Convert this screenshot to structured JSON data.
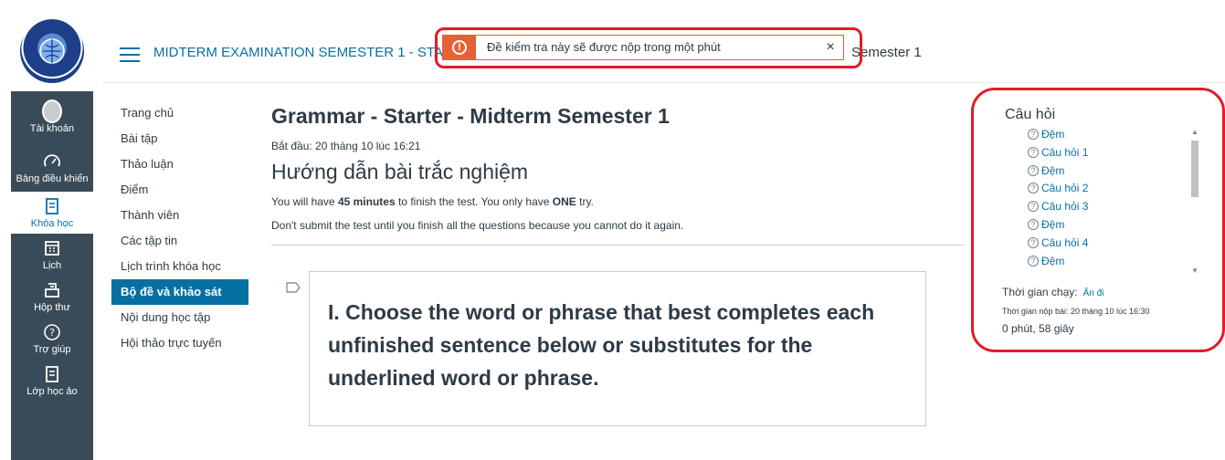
{
  "header": {
    "course_title": "MIDTERM EXAMINATION SEMESTER 1 - STA",
    "course_title_tail": "Semester 1"
  },
  "alert": {
    "icon": "exclamation-icon",
    "message": "Đề kiểm tra này sẽ được nộp trong một phút",
    "close_label": "×",
    "accent_color": "#e66135"
  },
  "global_nav": {
    "items": [
      {
        "label": "Tài khoản",
        "icon": "account-avatar-icon"
      },
      {
        "label": "Bảng điều khiển",
        "icon": "dashboard-icon"
      },
      {
        "label": "Khóa học",
        "icon": "courses-icon",
        "active": true
      },
      {
        "label": "Lịch",
        "icon": "calendar-icon"
      },
      {
        "label": "Hộp thư",
        "icon": "inbox-icon"
      },
      {
        "label": "Trợ giúp",
        "icon": "help-icon"
      },
      {
        "label": "Lớp học ảo",
        "icon": "virtual-class-icon"
      }
    ]
  },
  "course_nav": {
    "items": [
      {
        "label": "Trang chủ"
      },
      {
        "label": "Bài tập"
      },
      {
        "label": "Thảo luận"
      },
      {
        "label": "Điểm"
      },
      {
        "label": "Thành viên"
      },
      {
        "label": "Các tập tin"
      },
      {
        "label": "Lịch trình khóa học"
      },
      {
        "label": "Bộ đề và khảo sát",
        "active": true
      },
      {
        "label": "Nội dung học tập"
      },
      {
        "label": "Hội thảo trực tuyến"
      }
    ]
  },
  "quiz": {
    "title": "Grammar - Starter - Midterm Semester 1",
    "started": "Bắt đầu: 20 tháng 10 lúc 16:21",
    "instructions_title": "Hướng dẫn bài trắc nghiệm",
    "line1_pre": "You will have ",
    "line1_bold1": "45 minutes",
    "line1_mid": " to finish the test. You only have ",
    "line1_bold2": "ONE",
    "line1_post": " try.",
    "line2": "Don't submit the test until you finish all the questions because you cannot do it again.",
    "question_text": "I. Choose the word or phrase that best completes each unfinished sentence below or substitutes for the underlined word or phrase."
  },
  "questions_panel": {
    "title": "Câu hỏi",
    "items": [
      {
        "label": "Đệm"
      },
      {
        "label": "Câu hỏi 1"
      },
      {
        "label": "Đệm"
      },
      {
        "label": "Câu hỏi 2"
      },
      {
        "label": "Câu hỏi 3"
      },
      {
        "label": "Đệm"
      },
      {
        "label": "Câu hỏi 4"
      },
      {
        "label": "Đệm"
      }
    ],
    "timer_label": "Thời gian chạy:",
    "hide_label": "Ẩn đi",
    "due": "Thời gian nộp bài: 20 tháng 10 lúc 16:30",
    "elapsed": "0 phút, 58 giây"
  }
}
